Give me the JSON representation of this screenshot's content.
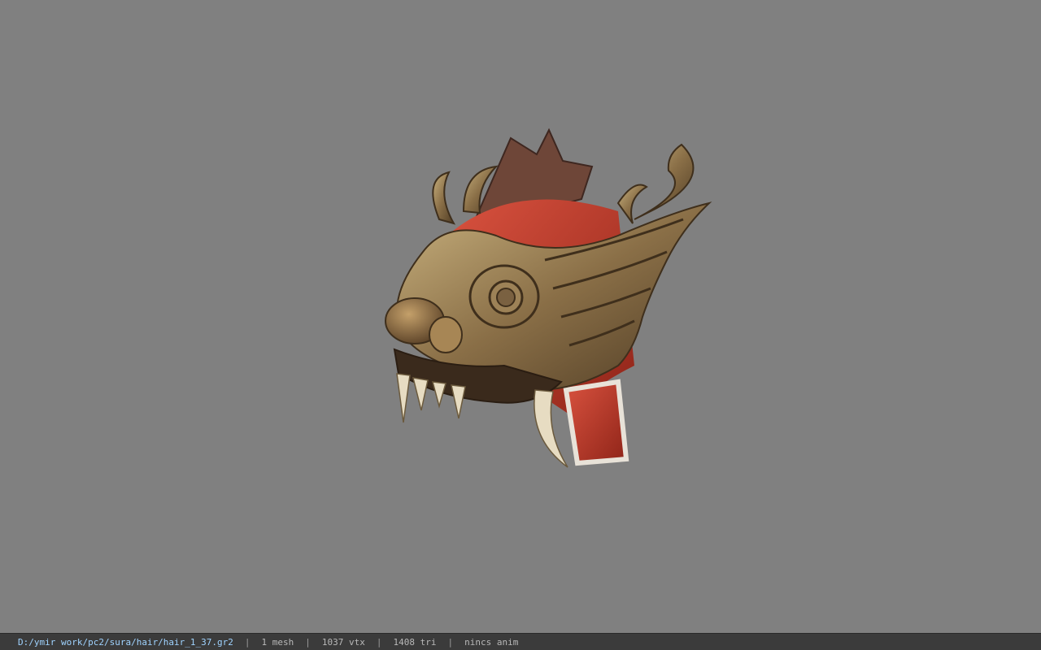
{
  "viewport": {
    "background_color": "#808080",
    "model_icon": "dragon-helmet-model"
  },
  "status_bar": {
    "file_path": "D:/ymir work/pc2/sura/hair/hair_1_37.gr2",
    "separator": "|",
    "mesh_count": "1 mesh",
    "vertex_count": "1037 vtx",
    "triangle_count": "1408 tri",
    "anim_info": "nincs anim"
  }
}
